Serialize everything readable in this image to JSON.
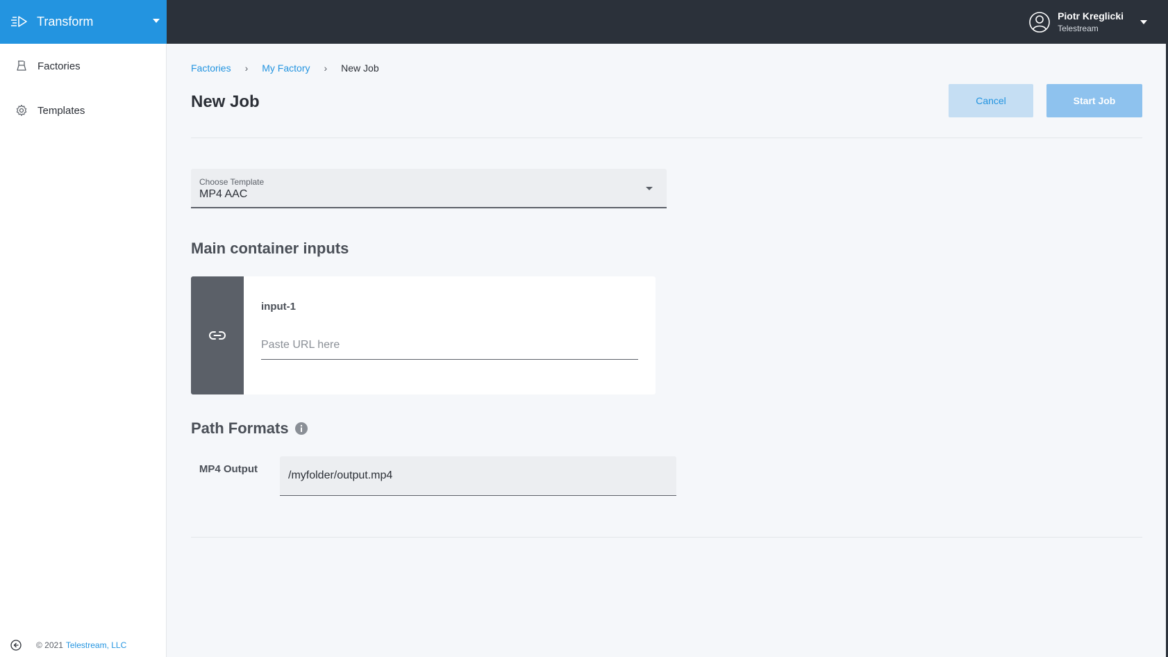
{
  "app": {
    "name": "Transform",
    "logo_icon": "transform-logo-icon"
  },
  "user": {
    "name": "Piotr Kreglicki",
    "org": "Telestream"
  },
  "sidebar": {
    "items": [
      {
        "label": "Factories",
        "icon": "factory-icon"
      },
      {
        "label": "Templates",
        "icon": "gear-icon"
      }
    ],
    "footer": {
      "copyright": "© 2021",
      "company": "Telestream, LLC"
    }
  },
  "breadcrumb": {
    "items": [
      "Factories",
      "My Factory"
    ],
    "current": "New Job"
  },
  "page": {
    "title": "New Job",
    "cancel_label": "Cancel",
    "start_label": "Start Job"
  },
  "template_select": {
    "label": "Choose Template",
    "value": "MP4 AAC"
  },
  "inputs_section": {
    "title": "Main container inputs",
    "card": {
      "label": "input-1",
      "placeholder": "Paste URL here"
    }
  },
  "path_formats": {
    "title": "Path Formats",
    "rows": [
      {
        "label": "MP4 Output",
        "value": "/myfolder/output.mp4"
      }
    ]
  },
  "colors": {
    "accent": "#2394e0",
    "topbar": "#2b313a",
    "card_side": "#5b6068"
  }
}
